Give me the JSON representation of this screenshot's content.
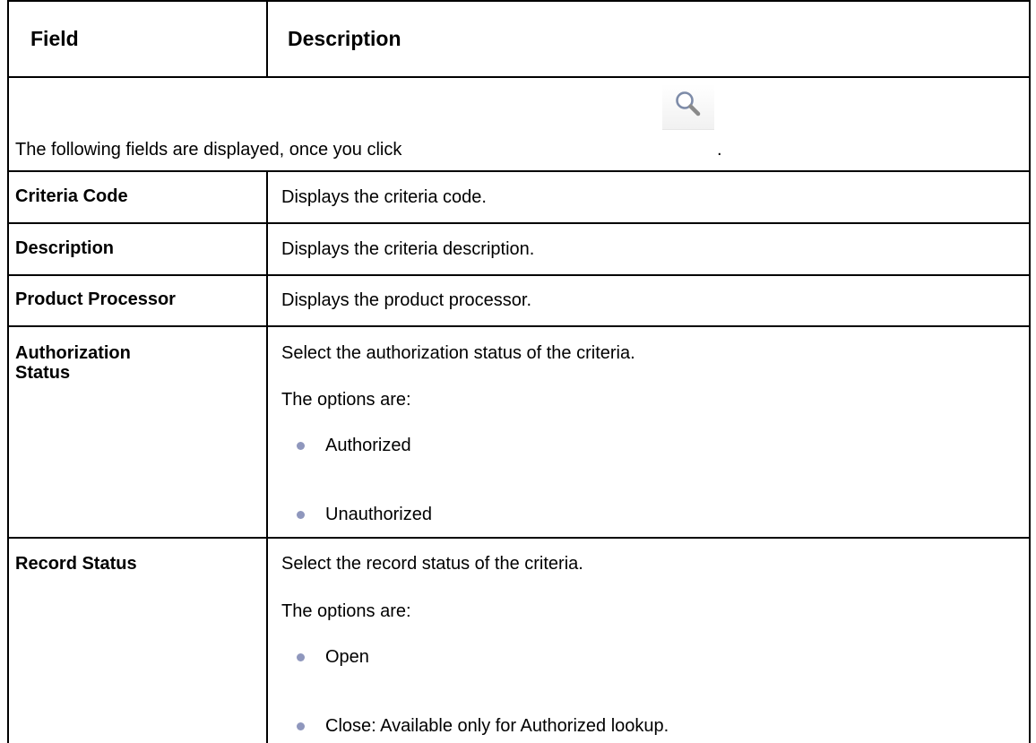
{
  "header": {
    "field": "Field",
    "description": "Description"
  },
  "intro": {
    "text": "The following fields are displayed, once you click",
    "trailing": ".",
    "icon": "search-icon"
  },
  "rows": [
    {
      "field": "Criteria Code",
      "description": "Displays the criteria code."
    },
    {
      "field": "Description",
      "description": "Displays the criteria description."
    },
    {
      "field": "Product Processor",
      "description": "Displays the product processor."
    },
    {
      "field_line1": "Authorization",
      "field_line2": "Status",
      "description": "Select the authorization status of the criteria.",
      "options_label": "The options are:",
      "options": [
        "Authorized",
        "Unauthorized"
      ]
    },
    {
      "field": "Record Status",
      "description": "Select the record status of the criteria.",
      "options_label": "The options are:",
      "options": [
        "Open",
        "Close: Available only for Authorized lookup."
      ]
    }
  ],
  "colors": {
    "bullet": "#8f97bd",
    "border": "#000000"
  }
}
